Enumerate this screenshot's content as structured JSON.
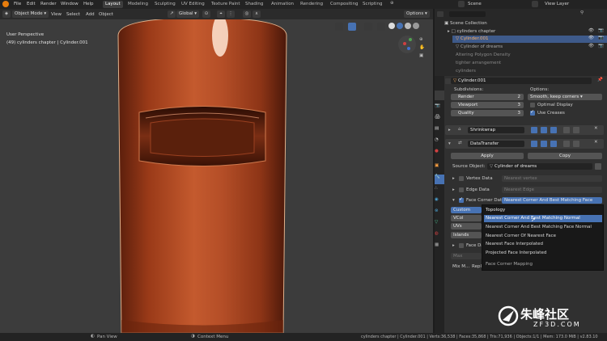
{
  "topbar": {
    "menus": [
      "File",
      "Edit",
      "Render",
      "Window",
      "Help"
    ],
    "workspaces": [
      "Layout",
      "Modeling",
      "Sculpting",
      "UV Editing",
      "Texture Paint",
      "Shading",
      "Animation",
      "Rendering",
      "Compositing",
      "Scripting"
    ],
    "scene": "Scene",
    "view_layer": "View Layer"
  },
  "viewport_header": {
    "mode": "Object Mode",
    "menus": [
      "View",
      "Select",
      "Add",
      "Object"
    ],
    "orientation": "Global",
    "options": "Options"
  },
  "viewport": {
    "perspective": "User Perspective",
    "object_info": "(49) cylinders chapter | Cylinder.001"
  },
  "outliner": {
    "root": "Scene Collection",
    "items": [
      {
        "label": "cylinders chapter"
      },
      {
        "label": "Cylinder.001"
      },
      {
        "label": "Cylinder of dreams"
      },
      {
        "label": "Altering Polygon Density"
      },
      {
        "label": "tighter arrangement"
      },
      {
        "label": "cylinders"
      }
    ]
  },
  "properties": {
    "object_name": "Cylinder.001",
    "subdivisions_label": "Subdivisions:",
    "render_label": "Render",
    "render_value": "2",
    "viewport_label": "Viewport",
    "viewport_value": "3",
    "quality_label": "Quality",
    "quality_value": "3",
    "options_label": "Options:",
    "uv_smooth": "Smooth, keep corners",
    "optimal_display": "Optimal Display",
    "use_creases": "Use Creases",
    "modifier1": "Shrinkwrap",
    "modifier2": "DataTransfer",
    "apply": "Apply",
    "copy": "Copy",
    "source_object_label": "Source Object:",
    "source_object": "Cylinder of dreams",
    "vertex_data": "Vertex Data",
    "vertex_mapping": "Nearest vertex",
    "edge_data": "Edge Data",
    "edge_mapping": "Nearest Edge",
    "face_corner_data": "Face Corner Data",
    "face_corner_mapping": "Nearest Corner And Best Matching Face No...",
    "custom_normals": "Custom Norm",
    "vcol": "VCol",
    "uvs": "UVs",
    "islands": "Islands Hand",
    "face_data": "Face Data",
    "max_distance": "Max Distanc",
    "mix_mode": "Mix M...",
    "replace": "Repl"
  },
  "dropdown": {
    "title": "Topology",
    "items": [
      "Nearest Corner And Best Matching Normal",
      "Nearest Corner And Best Matching Face Normal",
      "Nearest Corner Of Nearest Face",
      "Nearest Face Interpolated",
      "Projected Face Interpolated"
    ],
    "footer": "Face Corner Mapping"
  },
  "statusbar": {
    "left1": "Pan View",
    "left2": "Context Menu",
    "info": "cylinders chapter | Cylinder.001 | Verts:36,538 | Faces:35,868 | Tris:71,936 | Objects:1/1 | Mem: 173.0 MiB | v2.83.10"
  },
  "watermark": {
    "brand": "朱峰社区",
    "url": "ZF3D.COM"
  },
  "colors": {
    "accent": "#4772b3",
    "object_orange": "#c8562a",
    "viewport_bg": "#3c3c3c"
  }
}
